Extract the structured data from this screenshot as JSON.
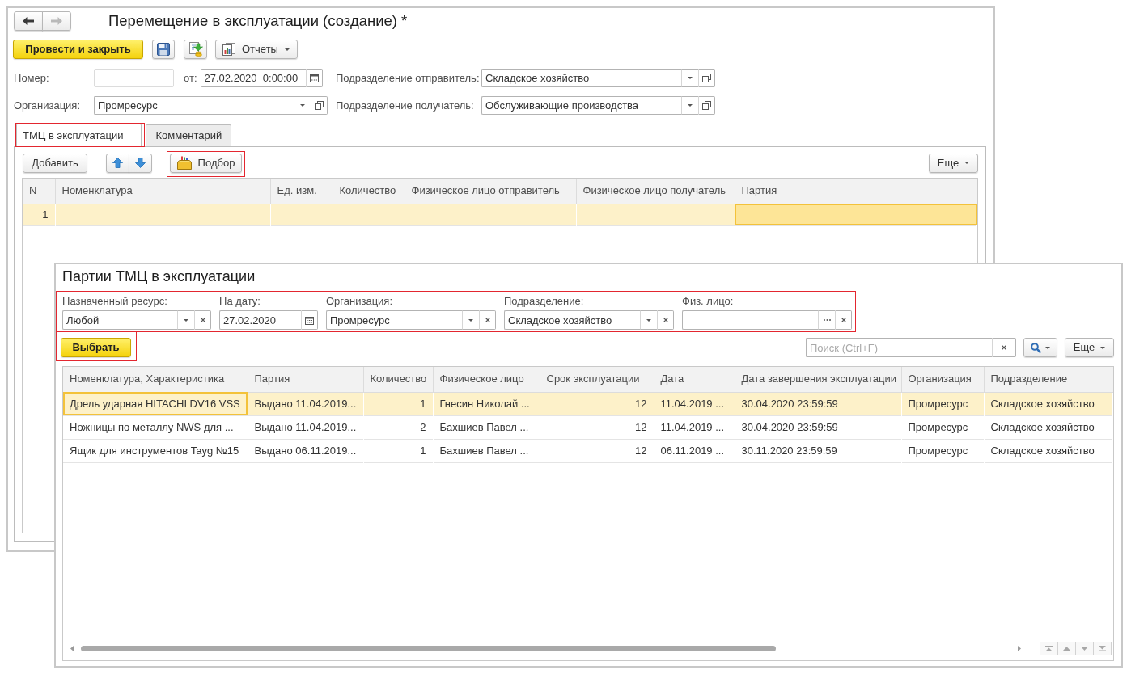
{
  "document_window": {
    "navigation": [
      {
        "kind": "back",
        "disabled": false
      },
      {
        "kind": "forward",
        "disabled": true
      }
    ],
    "title": "Перемещение в эксплуатации (создание) *",
    "toolbar": {
      "post_button": "Провести и закрыть",
      "reports_button": "Отчеты"
    },
    "header_rows": [
      {
        "fields": [
          {
            "label": "Номер:",
            "kind": "text"
          },
          {
            "label": "от:",
            "kind": "datetime",
            "value": "27.02.2020  0:00:00"
          },
          {
            "label": "Подразделение отправитель:",
            "kind": "reference",
            "value": "Складское хозяйство"
          }
        ]
      },
      {
        "fields": [
          {
            "label": "Организация:",
            "kind": "reference",
            "value": "Промресурс"
          },
          {
            "label": "Подразделение получатель:",
            "kind": "reference",
            "value": "Обслуживающие производства"
          }
        ]
      }
    ],
    "tabs": [
      {
        "label": "ТМЦ в эксплуатации",
        "selected": true,
        "highlighted": true
      },
      {
        "label": "Комментарий",
        "selected": false,
        "highlighted": false
      }
    ],
    "table_toolbar": {
      "add_button": "Добавить",
      "pick_button": {
        "label": "Подбор",
        "highlighted": true
      },
      "more_button": "Еще"
    },
    "table": {
      "columns": [
        {
          "title": "N",
          "kind": "number"
        },
        {
          "title": "Номенклатура",
          "kind": "text"
        },
        {
          "title": "Ед. изм.",
          "kind": "text"
        },
        {
          "title": "Количество",
          "kind": "text"
        },
        {
          "title": "Физическое лицо отправитель",
          "kind": "text"
        },
        {
          "title": "Физическое лицо получатель",
          "kind": "text"
        },
        {
          "title": "Партия",
          "kind": "text"
        }
      ],
      "rows": [
        {
          "selected": true,
          "cells": [
            {
              "text": "1",
              "active": false,
              "error": false
            },
            {
              "active": false,
              "error": false
            },
            {
              "active": false,
              "error": false
            },
            {
              "active": false,
              "error": false
            },
            {
              "active": false,
              "error": false
            },
            {
              "active": false,
              "error": false
            },
            {
              "active": true,
              "error": true
            }
          ]
        }
      ]
    }
  },
  "selection_window": {
    "title": "Партии ТМЦ в эксплуатации",
    "filters_highlighted": true,
    "filters": [
      {
        "label": "Назначенный ресурс:",
        "kind": "select",
        "value": "Любой"
      },
      {
        "label": "На дату:",
        "kind": "date",
        "value": "27.02.2020"
      },
      {
        "label": "Организация:",
        "kind": "select",
        "value": "Промресурс"
      },
      {
        "label": "Подразделение:",
        "kind": "select",
        "value": "Складское хозяйство"
      },
      {
        "label": "Физ. лицо:",
        "kind": "choice"
      }
    ],
    "choose_button": {
      "label": "Выбрать",
      "highlighted": true
    },
    "search": {
      "placeholder": "Поиск (Ctrl+F)"
    },
    "more_button": "Еще",
    "table": {
      "columns": [
        {
          "title": "Номенклатура, Характеристика",
          "kind": "text"
        },
        {
          "title": "Партия",
          "kind": "text"
        },
        {
          "title": "Количество",
          "kind": "number"
        },
        {
          "title": "Физическое лицо",
          "kind": "text"
        },
        {
          "title": "Срок эксплуатации",
          "kind": "number"
        },
        {
          "title": "Дата",
          "kind": "text"
        },
        {
          "title": "Дата завершения эксплуатации",
          "kind": "text"
        },
        {
          "title": "Организация",
          "kind": "text"
        },
        {
          "title": "Подразделение",
          "kind": "text"
        }
      ],
      "rows": [
        {
          "selected": true,
          "cells": [
            {
              "text": "Дрель ударная HITACHI DV16 VSS",
              "active": true
            },
            {
              "text": "Выдано 11.04.2019...",
              "active": false
            },
            {
              "text": "1",
              "active": false
            },
            {
              "text": "Гнесин Николай ...",
              "active": false
            },
            {
              "text": "12",
              "active": false
            },
            {
              "text": "11.04.2019 ...",
              "active": false
            },
            {
              "text": "30.04.2020 23:59:59",
              "active": false
            },
            {
              "text": "Промресурс",
              "active": false
            },
            {
              "text": "Складское хозяйство",
              "active": false
            }
          ]
        },
        {
          "selected": false,
          "cells": [
            {
              "text": "Ножницы по металлу NWS для ...",
              "active": false
            },
            {
              "text": "Выдано 11.04.2019...",
              "active": false
            },
            {
              "text": "2",
              "active": false
            },
            {
              "text": "Бахшиев Павел ...",
              "active": false
            },
            {
              "text": "12",
              "active": false
            },
            {
              "text": "11.04.2019 ...",
              "active": false
            },
            {
              "text": "30.04.2020 23:59:59",
              "active": false
            },
            {
              "text": "Промресурс",
              "active": false
            },
            {
              "text": "Складское хозяйство",
              "active": false
            }
          ]
        },
        {
          "selected": false,
          "cells": [
            {
              "text": "Ящик для инструментов Tayg №15",
              "active": false
            },
            {
              "text": "Выдано 06.11.2019...",
              "active": false
            },
            {
              "text": "1",
              "active": false
            },
            {
              "text": "Бахшиев Павел ...",
              "active": false
            },
            {
              "text": "12",
              "active": false
            },
            {
              "text": "06.11.2019 ...",
              "active": false
            },
            {
              "text": "30.11.2020 23:59:59",
              "active": false
            },
            {
              "text": "Промресурс",
              "active": false
            },
            {
              "text": "Складское хозяйство",
              "active": false
            }
          ]
        }
      ]
    }
  }
}
